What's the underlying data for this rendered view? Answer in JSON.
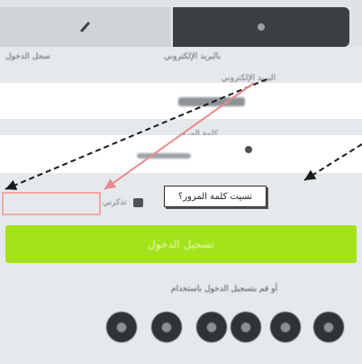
{
  "tabs": [
    {
      "key": "phone",
      "label": "سجل الدخول",
      "icon": "phone-icon",
      "active": false
    },
    {
      "key": "email",
      "label": "بالبريد الإلكتروني",
      "icon": "email-icon",
      "active": true
    }
  ],
  "form": {
    "email_label": "البريد الإلكتروني",
    "password_label": "كلمة المرور",
    "remember_label": "تذكرني",
    "forgot_tooltip": "نسيت كلمة المرور؟",
    "login_button": "تسجيل الدخول"
  },
  "social": {
    "heading": "أو قم بتسجيل الدخول باستخدام",
    "icons": [
      "facebook-icon",
      "twitter-icon",
      "google-icon",
      "linkedin-icon",
      "vk-icon",
      "github-icon"
    ]
  },
  "colors": {
    "accent": "#a4e21b",
    "annotation": "#f4a6a6",
    "active_tab": "#3b3f42"
  }
}
